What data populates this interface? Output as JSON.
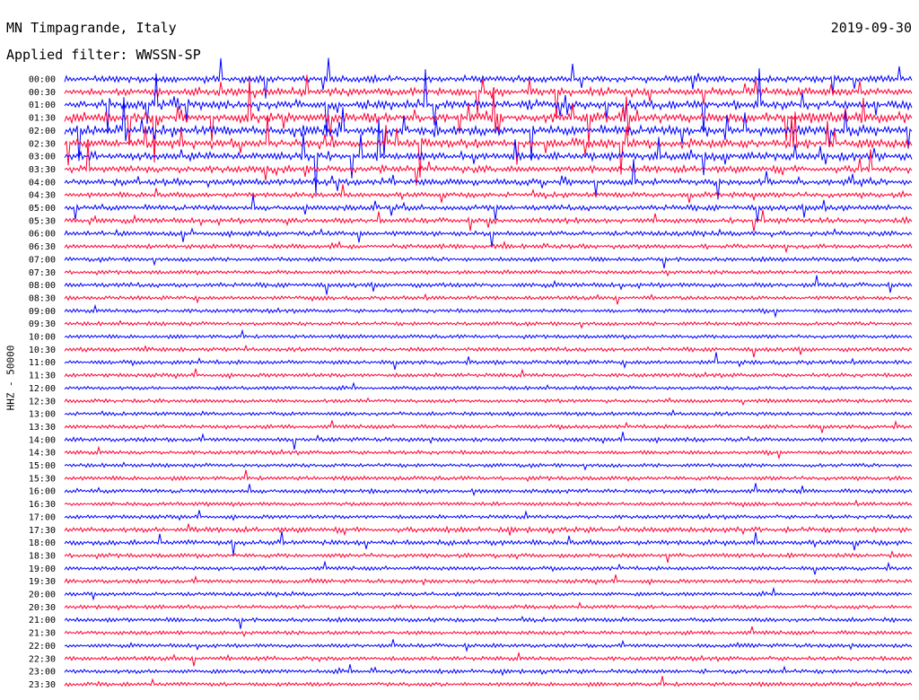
{
  "header": {
    "station": "MN Timpagrande, Italy",
    "date": "2019-09-30",
    "filter": "Applied filter: WWSSN-SP"
  },
  "channel_label": "HHZ - 50000",
  "colors": {
    "blue_trace": "#0000ff",
    "red_trace": "#ff0033",
    "background": "#ffffff",
    "text": "#000000"
  },
  "chart_data": {
    "type": "line",
    "title": "MN Timpagrande, Italy",
    "ylabel": "HHZ - 50000",
    "xlabel": "",
    "grid": false,
    "legend": "none",
    "row_interval_minutes": 30,
    "trace_colors_alternate": [
      "blue",
      "red"
    ],
    "row_labels": [
      "00:00",
      "00:30",
      "01:00",
      "01:30",
      "02:00",
      "02:30",
      "03:00",
      "03:30",
      "04:00",
      "04:30",
      "05:00",
      "05:30",
      "06:00",
      "06:30",
      "07:00",
      "07:30",
      "08:00",
      "08:30",
      "09:00",
      "09:30",
      "10:00",
      "10:30",
      "11:00",
      "11:30",
      "12:00",
      "12:30",
      "13:00",
      "13:30",
      "14:00",
      "14:30",
      "15:00",
      "15:30",
      "16:00",
      "16:30",
      "17:00",
      "17:30",
      "18:00",
      "18:30",
      "19:00",
      "19:30",
      "20:00",
      "20:30",
      "21:00",
      "21:30",
      "22:00",
      "22:30",
      "23:00",
      "23:30"
    ],
    "row_activity": [
      0.55,
      0.7,
      0.9,
      1.0,
      1.0,
      0.9,
      0.75,
      0.6,
      0.55,
      0.35,
      0.4,
      0.35,
      0.3,
      0.25,
      0.2,
      0.15,
      0.25,
      0.15,
      0.15,
      0.15,
      0.12,
      0.2,
      0.18,
      0.15,
      0.12,
      0.12,
      0.15,
      0.15,
      0.18,
      0.15,
      0.15,
      0.18,
      0.2,
      0.12,
      0.15,
      0.35,
      0.35,
      0.2,
      0.15,
      0.15,
      0.15,
      0.15,
      0.2,
      0.15,
      0.15,
      0.18,
      0.2,
      0.18
    ]
  }
}
